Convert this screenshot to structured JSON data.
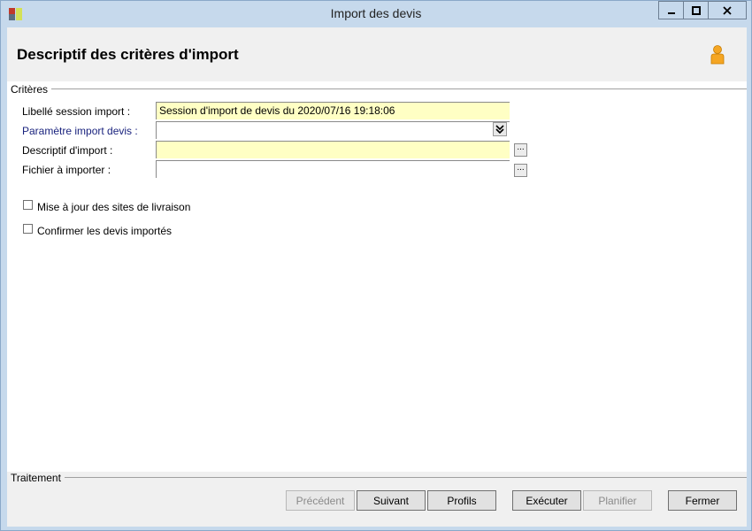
{
  "window": {
    "title": "Import des devis",
    "icon": "app-icon"
  },
  "header": {
    "title": "Descriptif des critères d'import",
    "user_icon": "user-icon"
  },
  "criteria": {
    "group_label": "Critères",
    "fields": [
      {
        "label": "Libellé session import :",
        "value": "Session d'import de devis du 2020/07/16 19:18:06"
      },
      {
        "label": "Paramètre import devis :",
        "value": ""
      },
      {
        "label": "Descriptif d'import :",
        "value": ""
      },
      {
        "label": "Fichier à importer :",
        "value": ""
      }
    ],
    "checkboxes": [
      {
        "label": "Mise à jour des sites de livraison",
        "checked": false
      },
      {
        "label": "Confirmer les devis importés",
        "checked": false
      }
    ],
    "ellipsis_label": "..."
  },
  "traitement": {
    "group_label": "Traitement"
  },
  "buttons": {
    "previous": "Précédent",
    "next": "Suivant",
    "profiles": "Profils",
    "execute": "Exécuter",
    "plan": "Planifier",
    "close": "Fermer"
  }
}
